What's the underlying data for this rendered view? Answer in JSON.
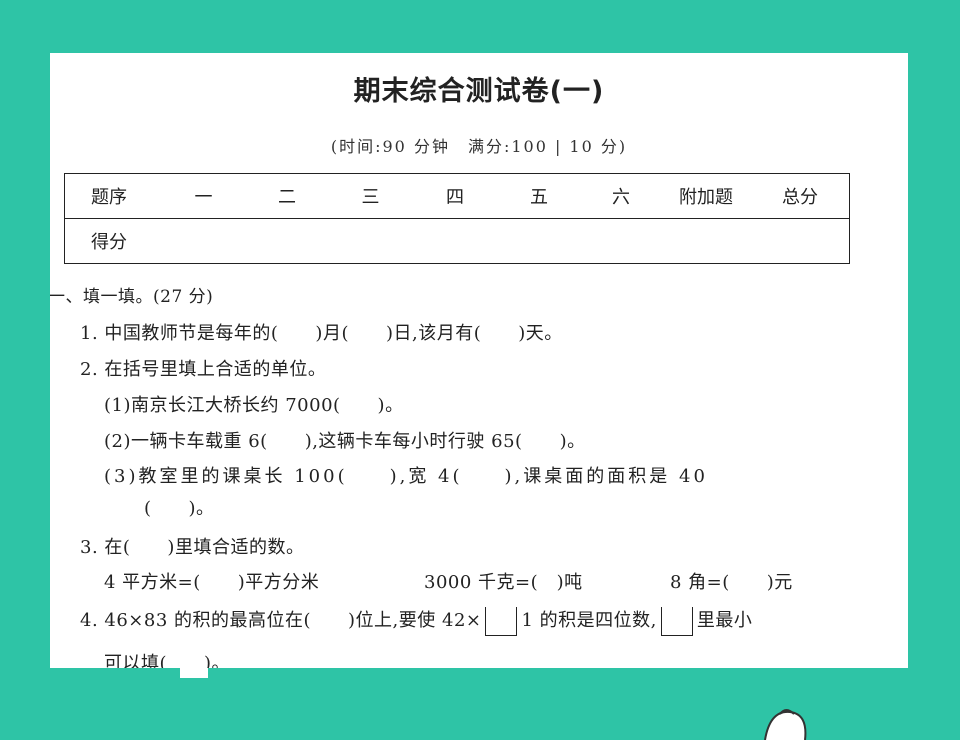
{
  "title": "期末综合测试卷(一)",
  "subtitle": "(时间:90 分钟　满分:100 | 10 分)",
  "score_table": {
    "headers": [
      "题序",
      "一",
      "二",
      "三",
      "四",
      "五",
      "六",
      "附加题",
      "总分"
    ],
    "row2_label": "得分"
  },
  "section1": {
    "heading": "一、填一填。(27 分)",
    "q1": "1. 中国教师节是每年的(　　)月(　　)日,该月有(　　)天。",
    "q2": "2. 在括号里填上合适的单位。",
    "q2_1": "(1)南京长江大桥长约 7000(　　)。",
    "q2_2": "(2)一辆卡车载重 6(　　),这辆卡车每小时行驶 65(　　)。",
    "q2_3a": "(3)教室里的课桌长 100(　　),宽 4(　　),课桌面的面积是 40",
    "q2_3b": "(　　)。",
    "q3": "3. 在(　　)里填合适的数。",
    "q3_a": "4 平方米=(　　)平方分米",
    "q3_b": "3000 千克=(　)吨",
    "q3_c": "8 角=(　　)元",
    "q4_a": "4. 46×83 的积的最高位在(　　)位上,要使 42×",
    "q4_b": "1 的积是四位数,",
    "q4_c": "里最小",
    "q4_d": "可以填(　　)。"
  }
}
